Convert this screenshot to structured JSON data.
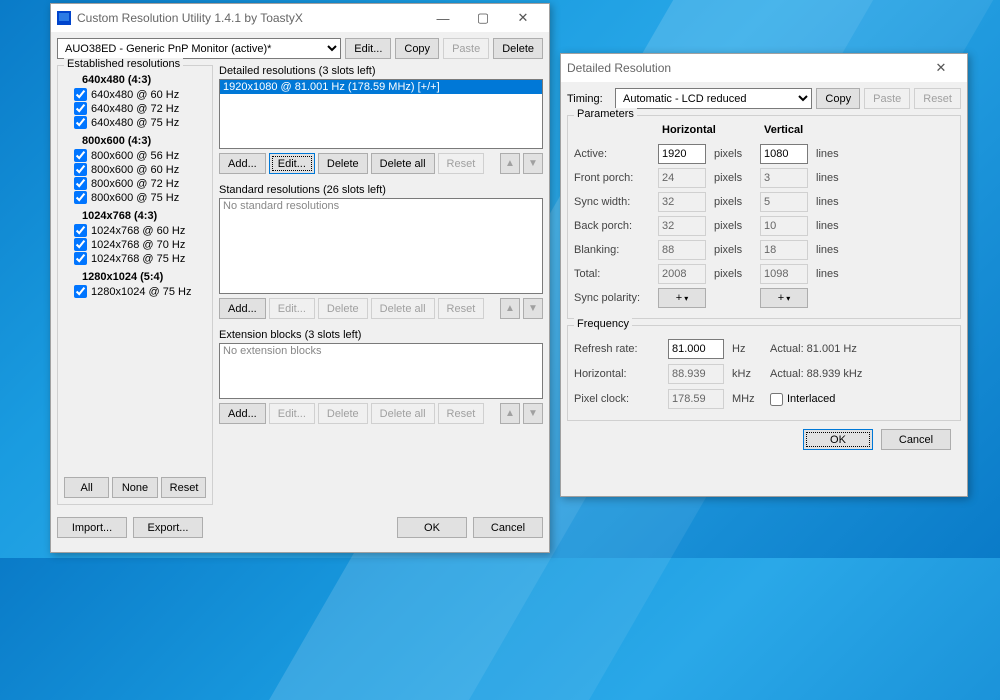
{
  "main": {
    "title": "Custom Resolution Utility 1.4.1 by ToastyX",
    "monitor": "AUO38ED - Generic PnP Monitor (active)*",
    "buttons": {
      "edit": "Edit...",
      "copy": "Copy",
      "paste": "Paste",
      "delete": "Delete"
    },
    "established": {
      "title": "Established resolutions",
      "groups": [
        {
          "header": "640x480 (4:3)",
          "items": [
            "640x480 @ 60 Hz",
            "640x480 @ 72 Hz",
            "640x480 @ 75 Hz"
          ]
        },
        {
          "header": "800x600 (4:3)",
          "items": [
            "800x600 @ 56 Hz",
            "800x600 @ 60 Hz",
            "800x600 @ 72 Hz",
            "800x600 @ 75 Hz"
          ]
        },
        {
          "header": "1024x768 (4:3)",
          "items": [
            "1024x768 @ 60 Hz",
            "1024x768 @ 70 Hz",
            "1024x768 @ 75 Hz"
          ]
        },
        {
          "header": "1280x1024 (5:4)",
          "items": [
            "1280x1024 @ 75 Hz"
          ]
        }
      ],
      "all": "All",
      "none": "None",
      "reset": "Reset"
    },
    "detailed": {
      "title": "Detailed resolutions (3 slots left)",
      "item": "1920x1080 @ 81.001 Hz (178.59 MHz) [+/+]",
      "add": "Add...",
      "edit": "Edit...",
      "delete": "Delete",
      "deleteall": "Delete all",
      "reset": "Reset"
    },
    "standard": {
      "title": "Standard resolutions (26 slots left)",
      "empty": "No standard resolutions",
      "add": "Add...",
      "edit": "Edit...",
      "delete": "Delete",
      "deleteall": "Delete all",
      "reset": "Reset"
    },
    "extension": {
      "title": "Extension blocks (3 slots left)",
      "empty": "No extension blocks",
      "add": "Add...",
      "edit": "Edit...",
      "delete": "Delete",
      "deleteall": "Delete all",
      "reset": "Reset"
    },
    "import": "Import...",
    "export": "Export...",
    "ok": "OK",
    "cancel": "Cancel"
  },
  "dlg": {
    "title": "Detailed Resolution",
    "timing_lbl": "Timing:",
    "timing": "Automatic - LCD reduced",
    "copy": "Copy",
    "paste": "Paste",
    "reset": "Reset",
    "params": {
      "title": "Parameters",
      "col_h": "Horizontal",
      "col_v": "Vertical",
      "active": "Active:",
      "front": "Front porch:",
      "sync": "Sync width:",
      "back": "Back porch:",
      "blank": "Blanking:",
      "total": "Total:",
      "pol": "Sync polarity:",
      "h": {
        "active": "1920",
        "front": "24",
        "sync": "32",
        "back": "32",
        "blank": "88",
        "total": "2008"
      },
      "v": {
        "active": "1080",
        "front": "3",
        "sync": "5",
        "back": "10",
        "blank": "18",
        "total": "1098"
      },
      "u_px": "pixels",
      "u_ln": "lines",
      "plus": "+"
    },
    "freq": {
      "title": "Frequency",
      "refresh": "Refresh rate:",
      "refresh_v": "81.000",
      "refresh_u": "Hz",
      "refresh_a": "Actual: 81.001 Hz",
      "horiz": "Horizontal:",
      "horiz_v": "88.939",
      "horiz_u": "kHz",
      "horiz_a": "Actual: 88.939 kHz",
      "pixel": "Pixel clock:",
      "pixel_v": "178.59",
      "pixel_u": "MHz",
      "interlaced": "Interlaced"
    },
    "ok": "OK",
    "cancel": "Cancel"
  }
}
